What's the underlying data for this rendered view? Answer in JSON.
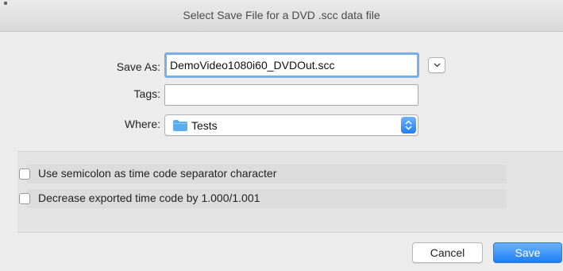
{
  "window": {
    "title": "Select Save File for a DVD .scc data file"
  },
  "form": {
    "save_as_label": "Save As:",
    "save_as_value": "DemoVideo1080i60_DVDOut.scc",
    "tags_label": "Tags:",
    "tags_value": "",
    "where_label": "Where:",
    "where_value": "Tests",
    "where_icon": "folder-icon",
    "expand_icon": "chevron-down-icon",
    "stepper_icon": "updown-arrows-icon"
  },
  "options": [
    {
      "label": "Use semicolon as time code separator character",
      "checked": false
    },
    {
      "label": "Decrease exported time code by 1.000/1.001",
      "checked": false
    }
  ],
  "buttons": {
    "cancel": "Cancel",
    "save": "Save"
  },
  "colors": {
    "accent": "#1f7ff5",
    "focus_ring": "#79aee8",
    "folder": "#5aaef0"
  }
}
